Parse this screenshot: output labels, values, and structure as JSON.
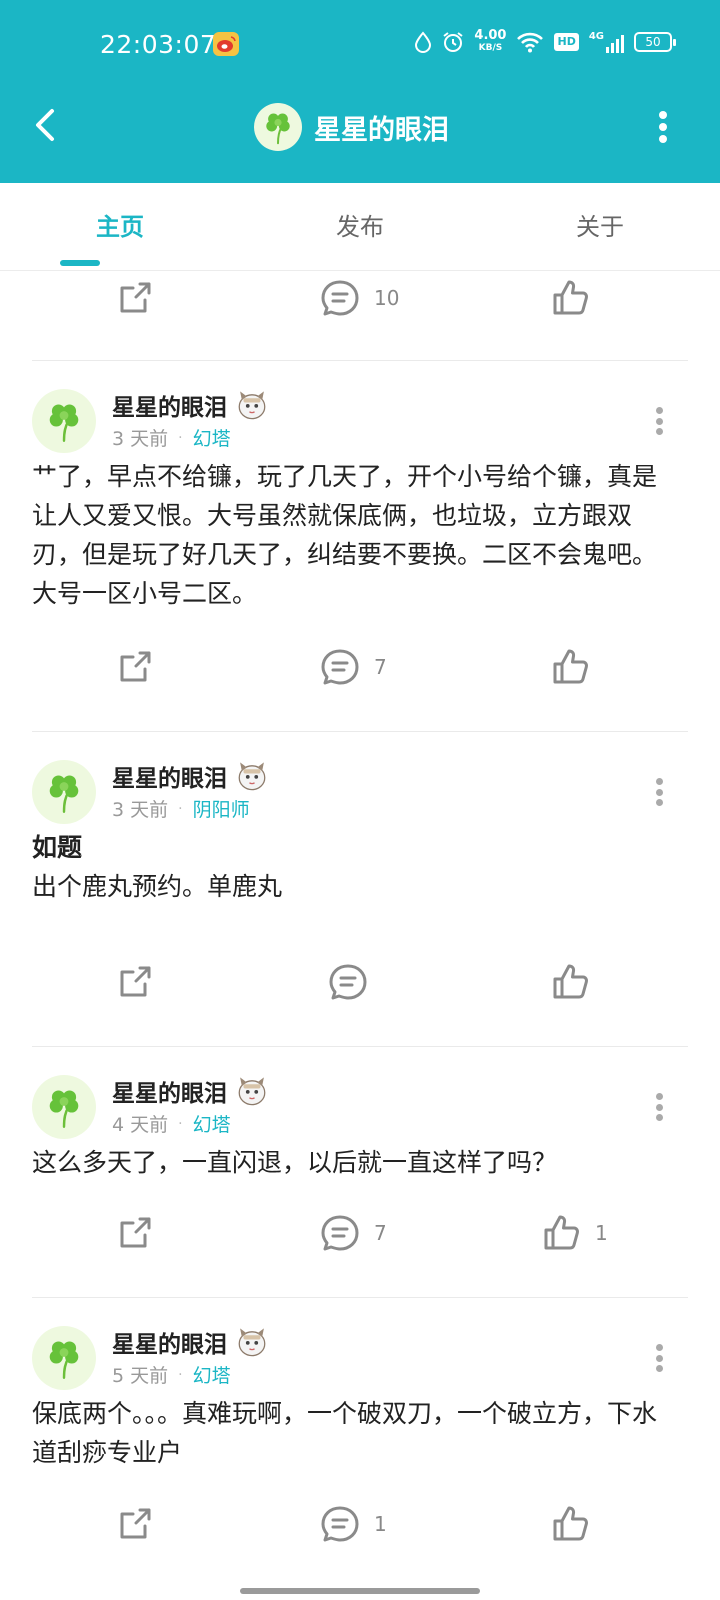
{
  "status_bar": {
    "time": "22:03:07",
    "net_speed": "4.00",
    "net_speed_unit": "KB/S",
    "hd": "HD",
    "signal": "4G",
    "battery": "50",
    "icons": [
      "weibo-icon",
      "drop-icon",
      "alarm-icon",
      "wifi-icon",
      "hd-icon",
      "signal-icon",
      "battery-icon"
    ]
  },
  "header": {
    "title": "星星的眼泪",
    "back_icon": "chevron-left-icon",
    "more_icon": "more-vertical-icon",
    "background": "#1bb6c5"
  },
  "tabs": [
    {
      "label": "主页",
      "active": true
    },
    {
      "label": "发布",
      "active": false
    },
    {
      "label": "关于",
      "active": false
    }
  ],
  "top_partial_actions": {
    "comment_count": "10",
    "like_count": ""
  },
  "posts": [
    {
      "author": "星星的眼泪",
      "time": "3 天前",
      "game": "幻塔",
      "title": "",
      "content": "艹了，早点不给镰，玩了几天了，开个小号给个镰，真是让人又爱又恨。大号虽然就保底俩，也垃圾，立方跟双刃，但是玩了好几天了，纠结要不要换。二区不会鬼吧。大号一区小号二区。",
      "comment_count": "7",
      "like_count": ""
    },
    {
      "author": "星星的眼泪",
      "time": "3 天前",
      "game": "阴阳师",
      "title": "如题",
      "content": "出个鹿丸预约。单鹿丸",
      "comment_count": "",
      "like_count": ""
    },
    {
      "author": "星星的眼泪",
      "time": "4 天前",
      "game": "幻塔",
      "title": "",
      "content": "这么多天了，一直闪退，以后就一直这样了吗？",
      "comment_count": "7",
      "like_count": "1"
    },
    {
      "author": "星星的眼泪",
      "time": "5 天前",
      "game": "幻塔",
      "title": "",
      "content": "保底两个。。。真难玩啊，一个破双刀，一个破立方，下水道刮痧专业户",
      "comment_count": "1",
      "like_count": ""
    }
  ],
  "colors": {
    "accent": "#1bb6c5",
    "text": "#222222",
    "muted": "#999999"
  }
}
